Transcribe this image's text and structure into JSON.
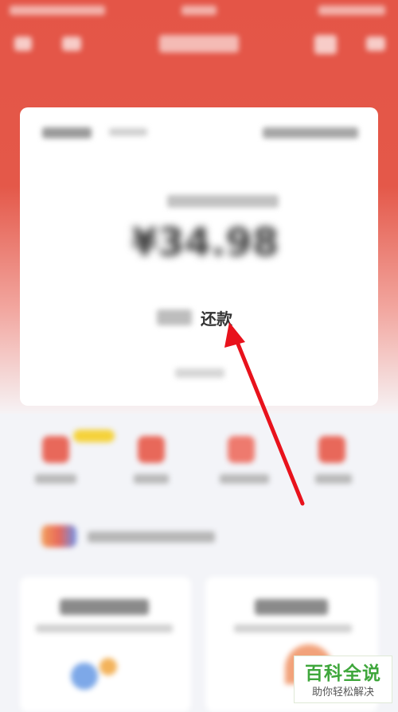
{
  "card": {
    "amount": "¥34.98",
    "repay_label": "还款"
  },
  "watermark": {
    "title": "百科全说",
    "subtitle": "助你轻松解决"
  },
  "colors": {
    "header_red": "#e45547",
    "annotation_arrow": "#e8121c",
    "watermark_green": "#3fa73c"
  },
  "icons": {
    "nav": [
      "back-icon",
      "home-icon",
      "message-icon",
      "more-icon"
    ],
    "quick": [
      "gift-icon",
      "wallet-icon",
      "discount-icon",
      "coupon-icon"
    ]
  }
}
